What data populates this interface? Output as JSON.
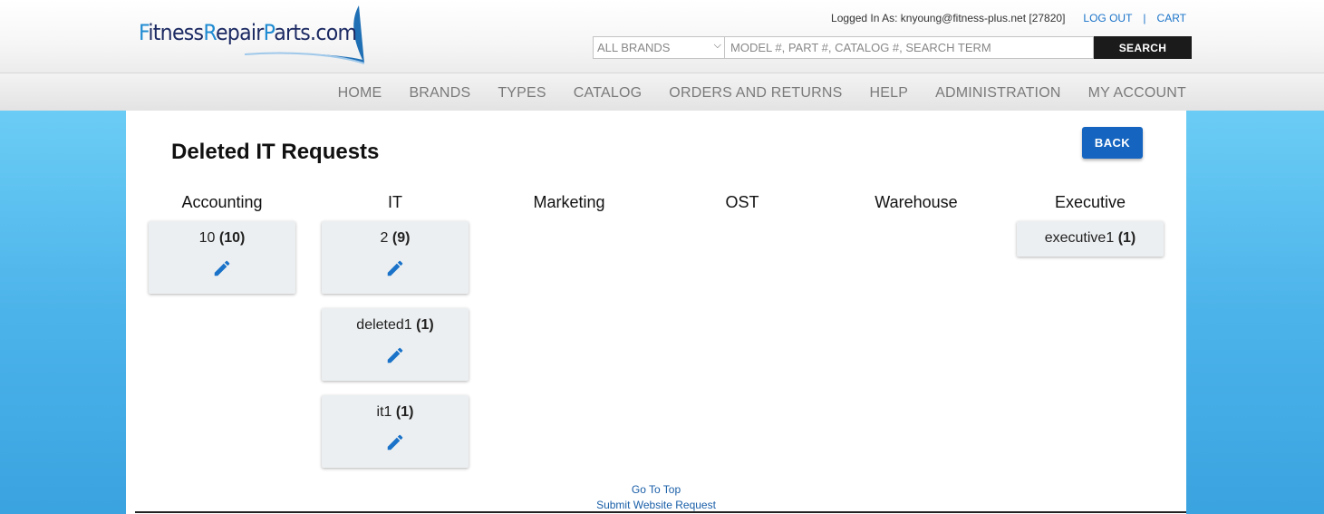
{
  "header": {
    "logo_text_parts": [
      "F",
      "itness",
      "R",
      "epair",
      "P",
      "arts.com"
    ],
    "logged_in_label": "Logged In As: knyoung@fitness-plus.net [27820]",
    "logout_label": "LOG OUT",
    "separator": "|",
    "cart_label": "CART",
    "brand_select_value": "ALL BRANDS",
    "search_placeholder": "MODEL #, PART #, CATALOG #, SEARCH TERM",
    "search_button": "SEARCH"
  },
  "nav": {
    "items": [
      "HOME",
      "BRANDS",
      "TYPES",
      "CATALOG",
      "ORDERS AND RETURNS",
      "HELP",
      "ADMINISTRATION",
      "MY ACCOUNT"
    ]
  },
  "page": {
    "title": "Deleted IT Requests",
    "back_label": "BACK"
  },
  "columns": [
    {
      "title": "Accounting",
      "cards": [
        {
          "name": "10",
          "count": "(10)",
          "editable": true
        }
      ]
    },
    {
      "title": "IT",
      "cards": [
        {
          "name": "2",
          "count": "(9)",
          "editable": true
        },
        {
          "name": "deleted1",
          "count": "(1)",
          "editable": true
        },
        {
          "name": "it1",
          "count": "(1)",
          "editable": true
        }
      ]
    },
    {
      "title": "Marketing",
      "cards": []
    },
    {
      "title": "OST",
      "cards": []
    },
    {
      "title": "Warehouse",
      "cards": []
    },
    {
      "title": "Executive",
      "cards": [
        {
          "name": "executive1",
          "count": "(1)",
          "editable": false
        }
      ]
    }
  ],
  "footer": {
    "go_to_top": "Go To Top",
    "submit_request": "Submit Website Request"
  },
  "colors": {
    "accent_blue": "#1565c0",
    "edit_icon": "#1a73c9",
    "card_bg": "#eceff1"
  }
}
